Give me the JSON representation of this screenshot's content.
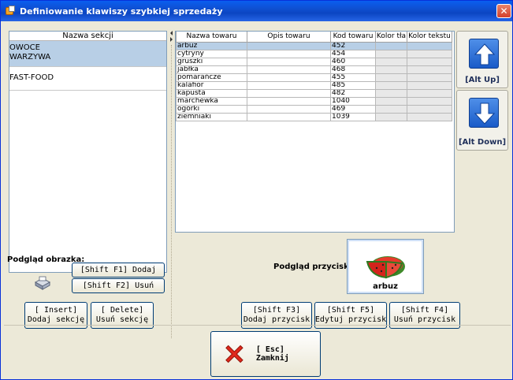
{
  "window": {
    "title": "Definiowanie klawiszy szybkiej sprzedaży",
    "close_glyph": "✕"
  },
  "sections": {
    "header": "Nazwa sekcji",
    "items": [
      {
        "line1": "OWOCE",
        "line2": "WARZYWA",
        "selected": true
      },
      {
        "line1": "FAST-FOOD",
        "line2": "",
        "selected": false
      }
    ]
  },
  "products": {
    "columns": [
      "Nazwa towaru",
      "Opis towaru",
      "Kod towaru",
      "Kolor tła",
      "Kolor tekstu"
    ],
    "rows": [
      {
        "name": "arbuz",
        "desc": "",
        "code": "452",
        "bg": "",
        "fg": "",
        "selected": true
      },
      {
        "name": "cytryny",
        "desc": "",
        "code": "454",
        "bg": "",
        "fg": ""
      },
      {
        "name": "gruszki",
        "desc": "",
        "code": "460",
        "bg": "",
        "fg": ""
      },
      {
        "name": "jabłka",
        "desc": "",
        "code": "468",
        "bg": "",
        "fg": ""
      },
      {
        "name": "pomarańcze",
        "desc": "",
        "code": "455",
        "bg": "",
        "fg": ""
      },
      {
        "name": "kalafior",
        "desc": "",
        "code": "485",
        "bg": "",
        "fg": ""
      },
      {
        "name": "kapusta",
        "desc": "",
        "code": "482",
        "bg": "",
        "fg": ""
      },
      {
        "name": "marchewka",
        "desc": "",
        "code": "1040",
        "bg": "",
        "fg": ""
      },
      {
        "name": "ogórki",
        "desc": "",
        "code": "469",
        "bg": "",
        "fg": ""
      },
      {
        "name": "ziemniaki",
        "desc": "",
        "code": "1039",
        "bg": "",
        "fg": ""
      }
    ]
  },
  "move": {
    "up_label": "[Alt Up]",
    "down_label": "[Alt Down]",
    "up_icon": "arrow-up-icon",
    "down_icon": "arrow-down-icon"
  },
  "image_preview": {
    "label": "Podgląd obrazka:",
    "icon": "printer-icon",
    "add_label": "[Shift F1] Dodaj",
    "remove_label": "[Shift F2] Usuń"
  },
  "section_buttons": {
    "insert_key": "[ Insert]",
    "insert_text": "Dodaj sekcję",
    "delete_key": "[ Delete]",
    "delete_text": "Usuń sekcję"
  },
  "button_preview": {
    "label": "Podgląd przycisku:",
    "name": "arbuz",
    "icon": "watermelon-icon"
  },
  "product_buttons": {
    "add_key": "[Shift F3]",
    "add_text": "Dodaj przycisk",
    "edit_key": "[Shift F5]",
    "edit_text": "Edytuj przycisk",
    "remove_key": "[Shift F4]",
    "remove_text": "Usuń przycisk"
  },
  "close_button": {
    "label": "[ Esc] Zamknij",
    "icon": "red-x-icon"
  },
  "colors": {
    "title_bar": "#0b45c2",
    "selection": "#b8cfe6",
    "arrow_blue": "#1a5bc8",
    "close_red": "#e0281c"
  }
}
